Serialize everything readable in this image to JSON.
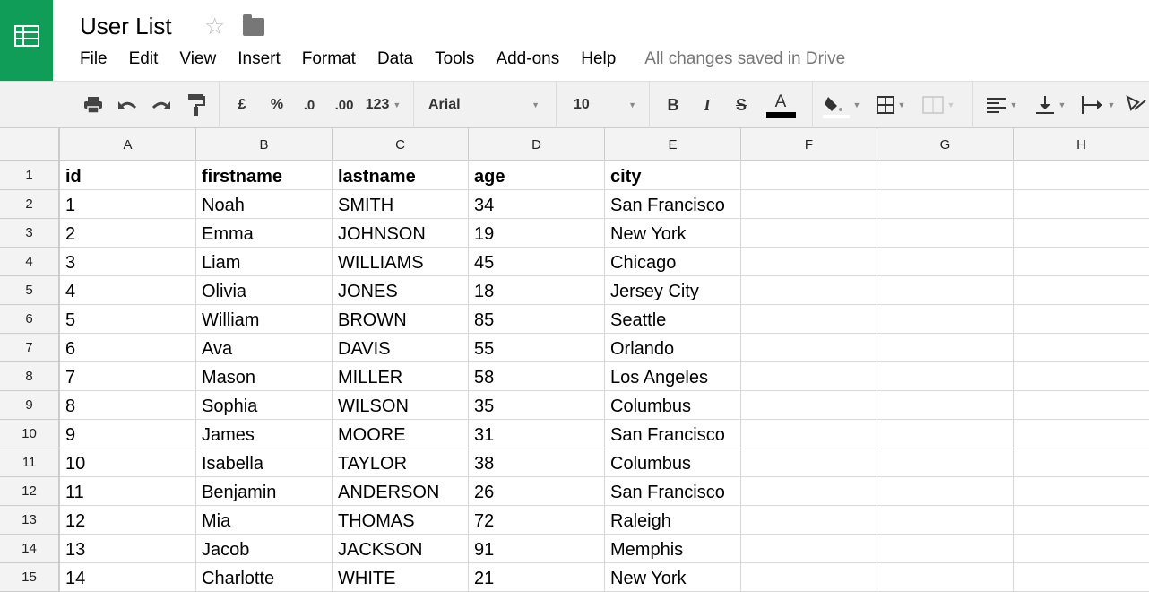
{
  "title": "User List",
  "menu": [
    "File",
    "Edit",
    "View",
    "Insert",
    "Format",
    "Data",
    "Tools",
    "Add-ons",
    "Help"
  ],
  "save_status": "All changes saved in Drive",
  "toolbar": {
    "currency": "£",
    "percent": "%",
    "dec_less": ".0",
    "dec_more": ".00",
    "number_format": "123",
    "font": "Arial",
    "font_size": "10",
    "bold": "B",
    "italic": "I",
    "strike": "S",
    "text_color": "A"
  },
  "columns": [
    "A",
    "B",
    "C",
    "D",
    "E",
    "F",
    "G",
    "H"
  ],
  "rows": [
    [
      "id",
      "firstname",
      "lastname",
      "age",
      "city"
    ],
    [
      "1",
      "Noah",
      "SMITH",
      "34",
      "San Francisco"
    ],
    [
      "2",
      "Emma",
      "JOHNSON",
      "19",
      "New York"
    ],
    [
      "3",
      "Liam",
      "WILLIAMS",
      "45",
      "Chicago"
    ],
    [
      "4",
      "Olivia",
      "JONES",
      "18",
      "Jersey City"
    ],
    [
      "5",
      "William",
      "BROWN",
      "85",
      "Seattle"
    ],
    [
      "6",
      "Ava",
      "DAVIS",
      "55",
      "Orlando"
    ],
    [
      "7",
      "Mason",
      "MILLER",
      "58",
      "Los Angeles"
    ],
    [
      "8",
      "Sophia",
      "WILSON",
      "35",
      "Columbus"
    ],
    [
      "9",
      "James",
      "MOORE",
      "31",
      "San Francisco"
    ],
    [
      "10",
      "Isabella",
      "TAYLOR",
      "38",
      "Columbus"
    ],
    [
      "11",
      "Benjamin",
      "ANDERSON",
      "26",
      "San Francisco"
    ],
    [
      "12",
      "Mia",
      "THOMAS",
      "72",
      "Raleigh"
    ],
    [
      "13",
      "Jacob",
      "JACKSON",
      "91",
      "Memphis"
    ],
    [
      "14",
      "Charlotte",
      "WHITE",
      "21",
      "New York"
    ]
  ]
}
